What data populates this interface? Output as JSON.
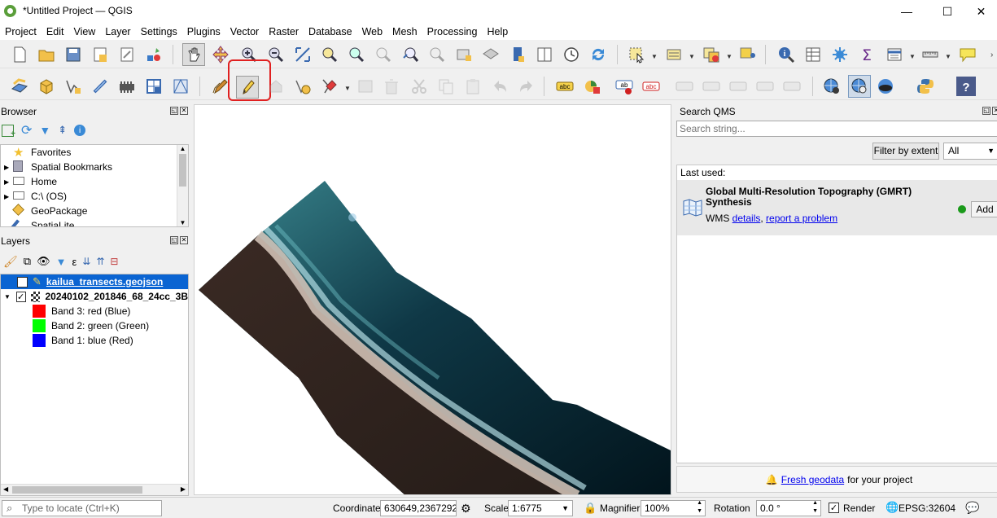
{
  "window": {
    "title": "*Untitled Project — QGIS",
    "minimize": "—",
    "maximize": "☐",
    "close": "✕"
  },
  "menu": [
    "Project",
    "Edit",
    "View",
    "Layer",
    "Settings",
    "Plugins",
    "Vector",
    "Raster",
    "Database",
    "Web",
    "Mesh",
    "Processing",
    "Help"
  ],
  "browser": {
    "title": "Browser",
    "items": [
      "Favorites",
      "Spatial Bookmarks",
      "Home",
      "C:\\ (OS)",
      "GeoPackage",
      "SpatiaLite"
    ]
  },
  "layers": {
    "title": "Layers",
    "items": [
      {
        "name": "kailua_transects.geojson",
        "checked": true,
        "selected": true
      },
      {
        "name": "20240102_201846_68_24cc_3B",
        "checked": true,
        "selected": false
      }
    ],
    "bands": [
      {
        "label": "Band 3: red (Blue)",
        "color": "#ff0000"
      },
      {
        "label": "Band 2: green (Green)",
        "color": "#00ff00"
      },
      {
        "label": "Band 1: blue (Red)",
        "color": "#0000ff"
      }
    ]
  },
  "qms": {
    "title": "Search QMS",
    "search_placeholder": "Search string...",
    "filter_button": "Filter by extent",
    "filter_select": "All",
    "last_used": "Last used:",
    "item_title": "Global Multi-Resolution Topography (GMRT) Synthesis",
    "item_type": "WMS",
    "details_link": "details",
    "report_link": "report a problem",
    "add_button": "Add",
    "status_color": "#1a9a1a",
    "footer_link": "Fresh geodata",
    "footer_text": "for your project"
  },
  "status": {
    "locate_placeholder": "Type to locate (Ctrl+K)",
    "coordinate_label": "Coordinate",
    "coordinate_value": "630649,2367292",
    "scale_label": "Scale",
    "scale_value": "1:6775",
    "magnifier_label": "Magnifier",
    "magnifier_value": "100%",
    "rotation_label": "Rotation",
    "rotation_value": "0.0 °",
    "render_label": "Render",
    "render_checked": true,
    "crs": "EPSG:32604"
  },
  "colors": {
    "accent": "#0078d7",
    "selection": "#0a64d2",
    "annotation": "#e02020"
  }
}
